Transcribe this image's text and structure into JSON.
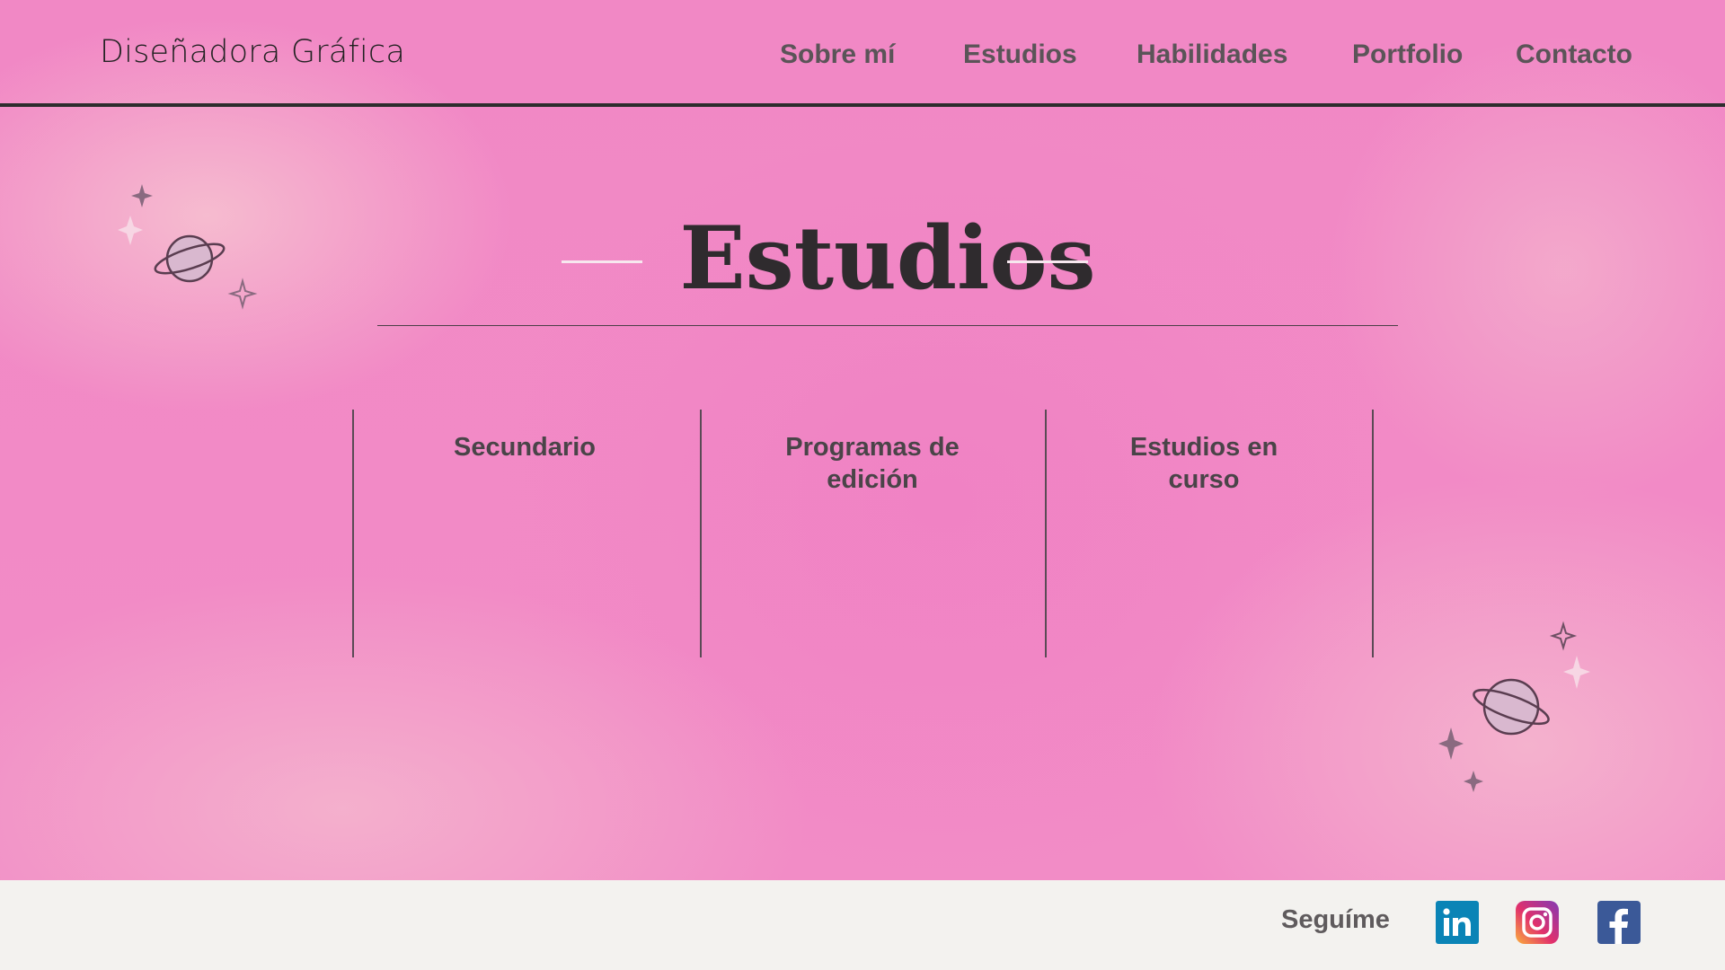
{
  "header": {
    "brand": "Diseñadora Gráfica",
    "nav": [
      "Sobre mí",
      "Estudios",
      "Habilidades",
      "Portfolio",
      "Contacto"
    ]
  },
  "section": {
    "title": "Estudios",
    "columns": [
      {
        "title": "Secundario"
      },
      {
        "title": "Programas de edición"
      },
      {
        "title": "Estudios en curso"
      }
    ]
  },
  "footer": {
    "follow_label": "Seguíme",
    "social": [
      {
        "name": "linkedin-icon",
        "color": "#0a84b6"
      },
      {
        "name": "instagram-icon",
        "color": "#c13584"
      },
      {
        "name": "facebook-icon",
        "color": "#3b5998"
      }
    ]
  },
  "colors": {
    "background_pink": "#f28cc6",
    "text_dark": "#2f2b2e",
    "nav_text": "#5b5458",
    "footer_bg": "#f3f2ef"
  }
}
